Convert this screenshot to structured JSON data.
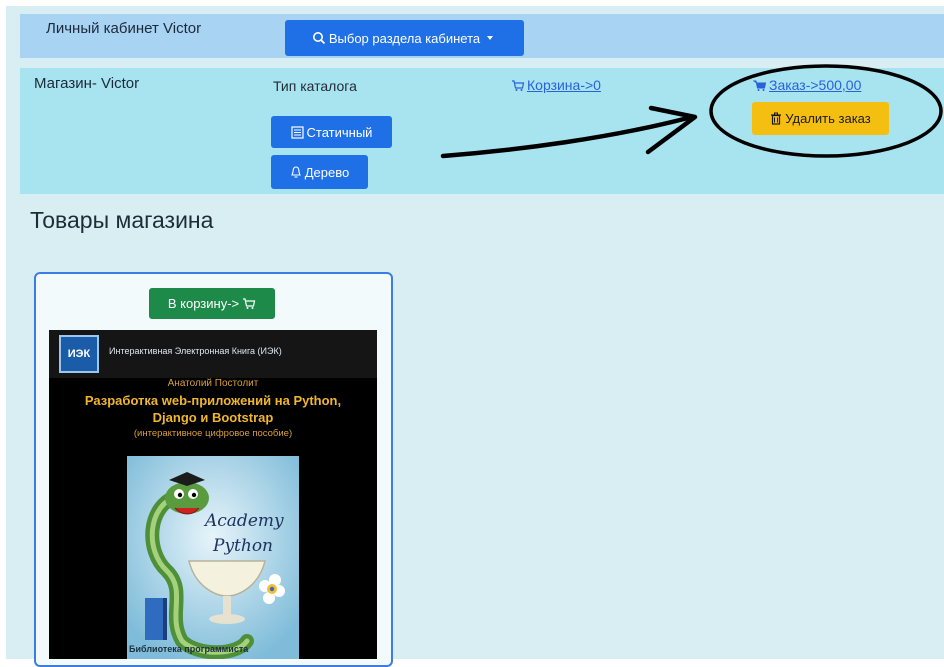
{
  "cabinet": {
    "title": "Личный кабинет Victor",
    "section_button": "Выбор раздела кабинета"
  },
  "shop": {
    "title": "Магазин- Victor",
    "catalog_type_label": "Тип каталога",
    "static_button": "Статичный",
    "tree_button": "Дерево",
    "cart_link": "Корзина->0",
    "order_link": "Заказ->500,00",
    "delete_order_button": "Удалить заказ"
  },
  "main": {
    "section_title": "Товары магазина"
  },
  "product": {
    "add_to_cart_button": "В корзину->",
    "cover": {
      "logo_text": "ИЭК",
      "series": "Интерактивная Электронная Книга (ИЭК)",
      "author": "Анатолий Постолит",
      "title_line1": "Разработка web-приложений на Python,",
      "title_line2": "Django и Bootstrap",
      "subtitle": "(интерактивное цифровое пособие)",
      "art_text_1": "Academy",
      "art_text_2": "Python",
      "footer": "Библиотека программиста"
    }
  },
  "colors": {
    "primary": "#1f6fe6",
    "success": "#1e8a4a",
    "warning": "#f5bf12",
    "link": "#2a62d8"
  },
  "icons": {
    "section_button": "search-icon",
    "section_caret": "caret-down-icon",
    "static": "list-icon",
    "tree": "bell-icon",
    "cart": "cart-icon",
    "order": "cart-icon",
    "delete": "trash-icon"
  }
}
